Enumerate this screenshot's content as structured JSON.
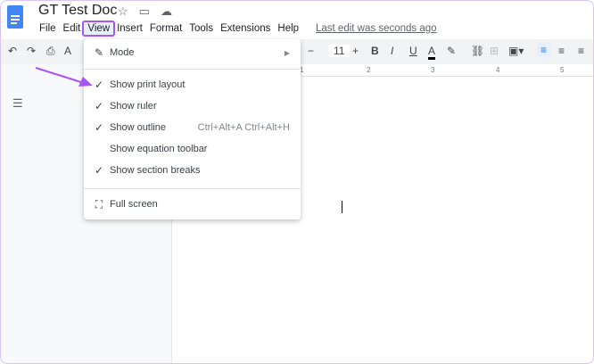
{
  "doc": {
    "title": "GT Test Doc",
    "last_edit": "Last edit was seconds ago"
  },
  "menubar": [
    "File",
    "Edit",
    "View",
    "Insert",
    "Format",
    "Tools",
    "Extensions",
    "Help"
  ],
  "toolbar": {
    "font_size": "11",
    "minus": "−",
    "plus": "+",
    "bold": "B",
    "italic": "I",
    "underline": "U",
    "text_color": "A",
    "text_color_value": "#000000"
  },
  "ruler": [
    "1",
    "2",
    "3",
    "4",
    "5"
  ],
  "view_menu": {
    "mode": "Mode",
    "items": [
      {
        "label": "Show print layout",
        "checked": true
      },
      {
        "label": "Show ruler",
        "checked": true
      },
      {
        "label": "Show outline",
        "checked": true,
        "shortcut": "Ctrl+Alt+A Ctrl+Alt+H"
      },
      {
        "label": "Show equation toolbar",
        "checked": false
      },
      {
        "label": "Show section breaks",
        "checked": true
      }
    ],
    "full_screen": "Full screen"
  },
  "colors": {
    "highlight": "#a855f7",
    "accent": "#1a73e8"
  }
}
